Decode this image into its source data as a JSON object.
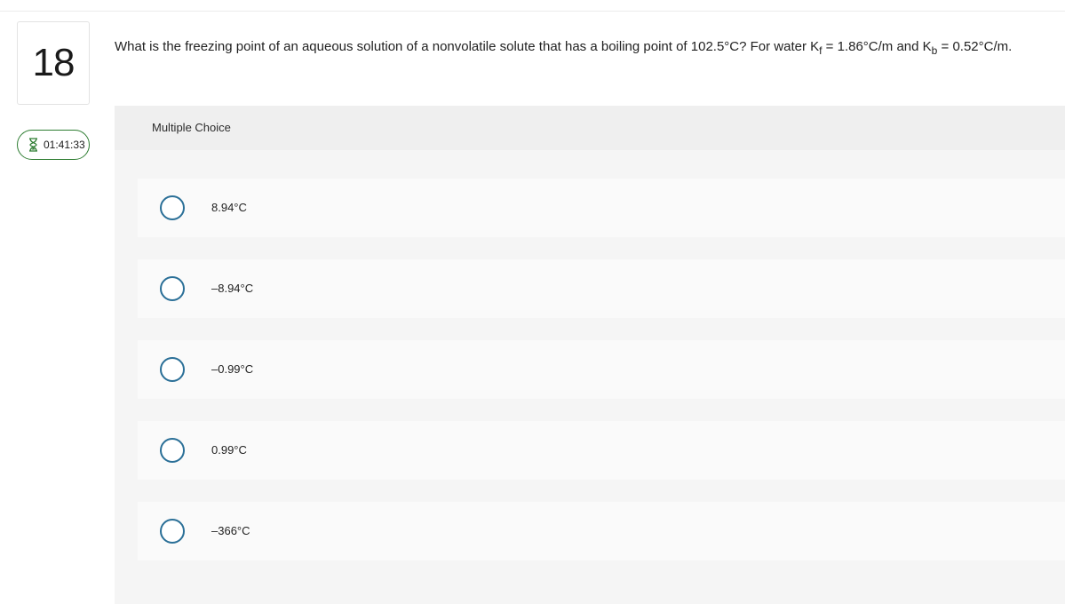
{
  "question": {
    "number": "18",
    "text_main": "What is the freezing point of an aqueous solution of a nonvolatile solute that has a boiling point of 102.5°C? For water K",
    "kf_sub": "f",
    "text_mid": " = 1.86°C/m and K",
    "kb_sub": "b",
    "text_end": " = 0.52°C/m."
  },
  "timer": {
    "value": "01:41:33",
    "icon": "hourglass-icon"
  },
  "answer_panel": {
    "label": "Multiple Choice",
    "options": [
      {
        "label": "8.94°C"
      },
      {
        "label": "–8.94°C"
      },
      {
        "label": "–0.99°C"
      },
      {
        "label": "0.99°C"
      },
      {
        "label": "–366°C"
      }
    ]
  },
  "colors": {
    "accent": "#2a6f97",
    "timer_border": "#2e7d32",
    "panel_bg": "#f5f5f5",
    "option_bg": "#fafafa"
  }
}
